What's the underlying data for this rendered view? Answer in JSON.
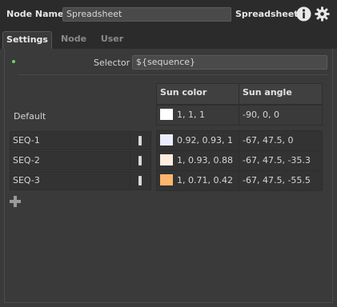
{
  "header": {
    "node_name_label": "Node Name",
    "node_name_value": "Spreadsheet",
    "node_type": "Spreadsheet",
    "info_icon": "info-icon",
    "settings_icon": "gear-icon"
  },
  "tabs": [
    {
      "label": "Settings",
      "active": true
    },
    {
      "label": "Node",
      "active": false
    },
    {
      "label": "User",
      "active": false
    }
  ],
  "selector": {
    "label": "Selector",
    "value": "${sequence}"
  },
  "table": {
    "columns": [
      "Sun color",
      "Sun angle"
    ],
    "default": {
      "label": "Default",
      "sun_color": "1, 1, 1",
      "sun_color_swatch": "#ffffff",
      "sun_angle": "-90, 0, 0"
    },
    "rows": [
      {
        "label": "SEQ-1",
        "sun_color": "0.92, 0.93, 1",
        "sun_color_swatch": "#ebedff",
        "sun_angle": "-67, 47.5, 0"
      },
      {
        "label": "SEQ-2",
        "sun_color": "1, 0.93, 0.88",
        "sun_color_swatch": "#ffede0",
        "sun_angle": "-67, 47.5, -35.3"
      },
      {
        "label": "SEQ-3",
        "sun_color": "1, 0.71, 0.42",
        "sun_color_swatch": "#ffb56b",
        "sun_angle": "-67, 47.5, -55.5"
      }
    ]
  },
  "add_row_icon": "plus-icon",
  "colors": {
    "background": "#3a3a3a",
    "header_background": "#2b2b2b",
    "active_indicator": "#6bd36b"
  }
}
